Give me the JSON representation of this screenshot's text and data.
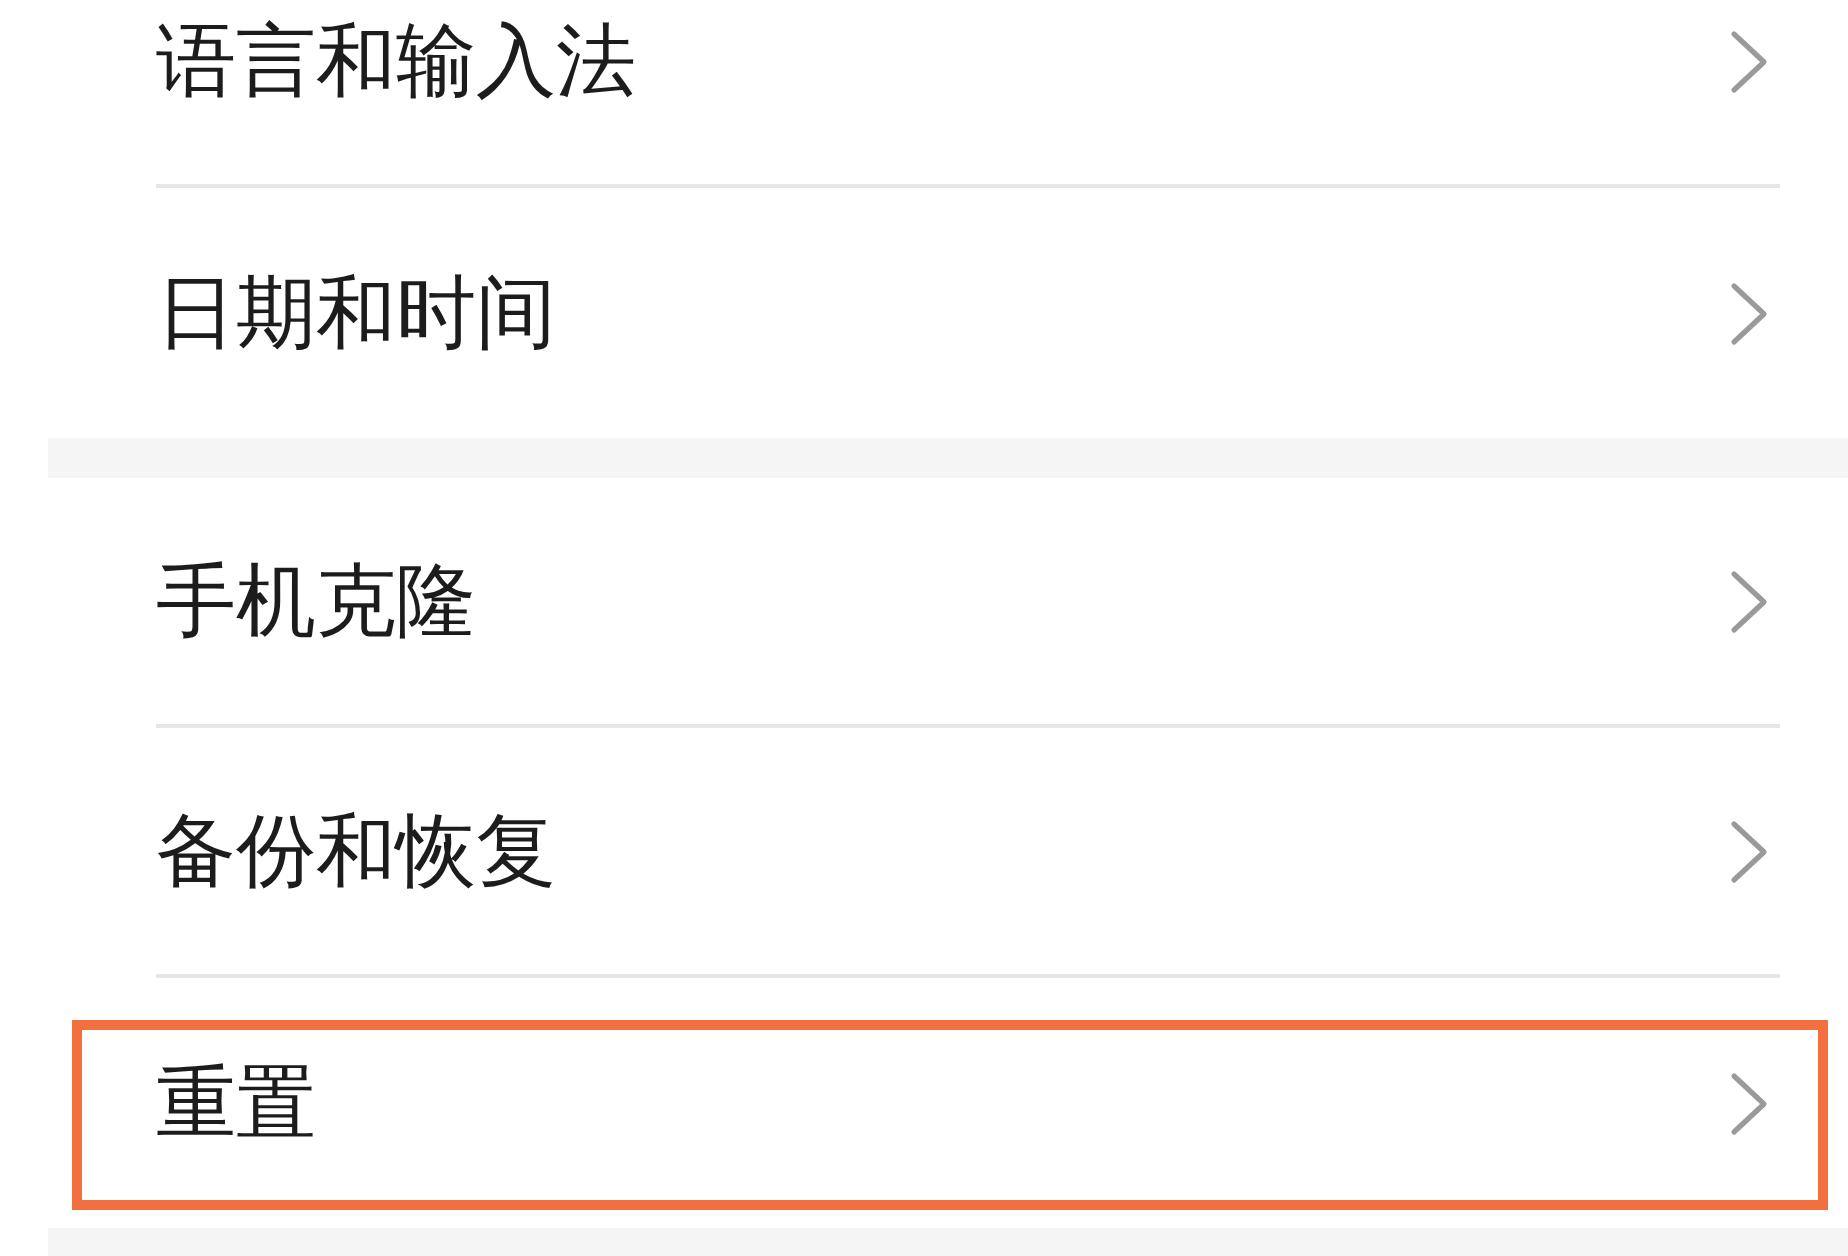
{
  "groups": [
    {
      "items": [
        {
          "label": "语言和输入法",
          "highlighted": false
        },
        {
          "label": "日期和时间",
          "highlighted": false
        }
      ]
    },
    {
      "items": [
        {
          "label": "手机克隆",
          "highlighted": false
        },
        {
          "label": "备份和恢复",
          "highlighted": false
        },
        {
          "label": "重置",
          "highlighted": true
        }
      ]
    }
  ]
}
